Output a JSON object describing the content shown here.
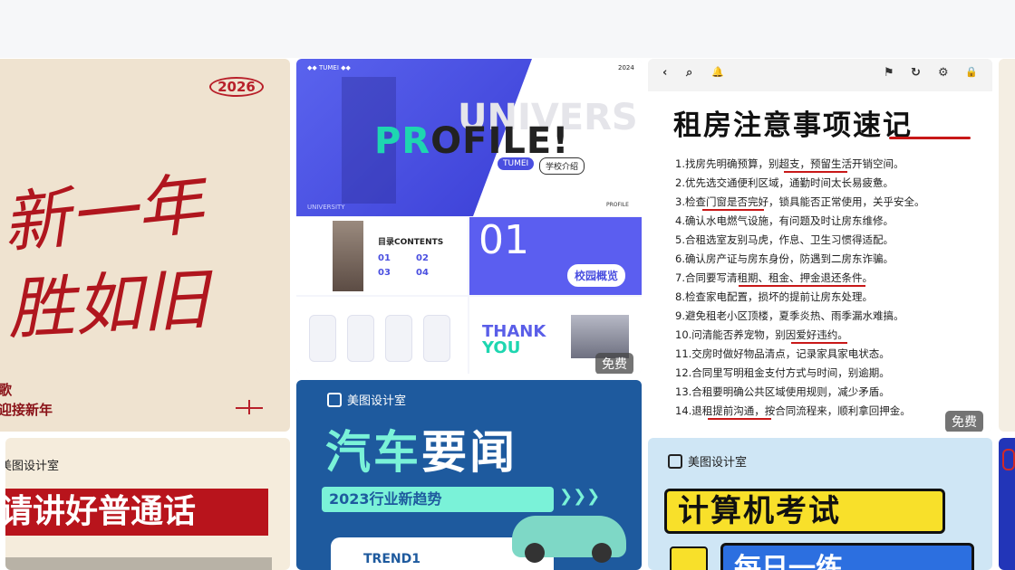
{
  "cards": {
    "newyear": {
      "year": "2026",
      "line1": "新一年",
      "line2": "胜如旧",
      "sub1": "歌",
      "sub2": "迎接新年"
    },
    "mandarin": {
      "header": "美图设计室",
      "title": "请讲好普通话"
    },
    "profile": {
      "tag_left": "◆◆ TUMEI ◆◆",
      "year": "2024",
      "ghost": "UNIVERS",
      "headline_accent": "PR",
      "headline_rest": "OFILE!",
      "pill1": "TUMEI",
      "pill2": "学校介绍",
      "uni": "UNIVERSITY",
      "profile_small": "PROFILE",
      "menu_title": "目录CONTENTS",
      "menu_items": [
        "01",
        "02",
        "03",
        "04"
      ],
      "section_num": "01",
      "section_pill": "校园概览",
      "thank": "THANK",
      "you": "YOU",
      "badge": "免费"
    },
    "car_news": {
      "logo": "美图设计室",
      "headline_a": "汽车",
      "headline_b": "要闻",
      "subtitle": "2023行业新趋势",
      "arrows": "❯❯❯",
      "trend": "TREND1"
    },
    "rent": {
      "toolbar": [
        "‹",
        "⌕",
        "🔔",
        "⚑",
        "↻",
        "⚙",
        "🔒"
      ],
      "title": "租房注意事项速记",
      "items": [
        "1.找房先明确预算，别超支，预留生活开销空间。",
        "2.优先选交通便利区域，通勤时间太长易疲惫。",
        "3.检查门窗是否完好，锁具能否正常使用，关乎安全。",
        "4.确认水电燃气设施，有问题及时让房东维修。",
        "5.合租选室友别马虎，作息、卫生习惯得适配。",
        "6.确认房产证与房东身份，防遇到二房东诈骗。",
        "7.合同要写清租期、租金、押金退还条件。",
        "8.检查家电配置，损坏的提前让房东处理。",
        "9.避免租老小区顶楼，夏季炎热、雨季漏水难搞。",
        "10.问清能否养宠物，别因爱好违约。",
        "11.交房时做好物品清点，记录家具家电状态。",
        "12.合同里写明租金支付方式与时间，别逾期。",
        "13.合租要明确公共区域使用规则，减少矛盾。",
        "14.退租提前沟通，按合同流程来，顺利拿回押金。"
      ],
      "badge": "免费"
    },
    "exam": {
      "logo": "美图设计室",
      "title": "计算机考试",
      "sub": "每日一练"
    }
  }
}
